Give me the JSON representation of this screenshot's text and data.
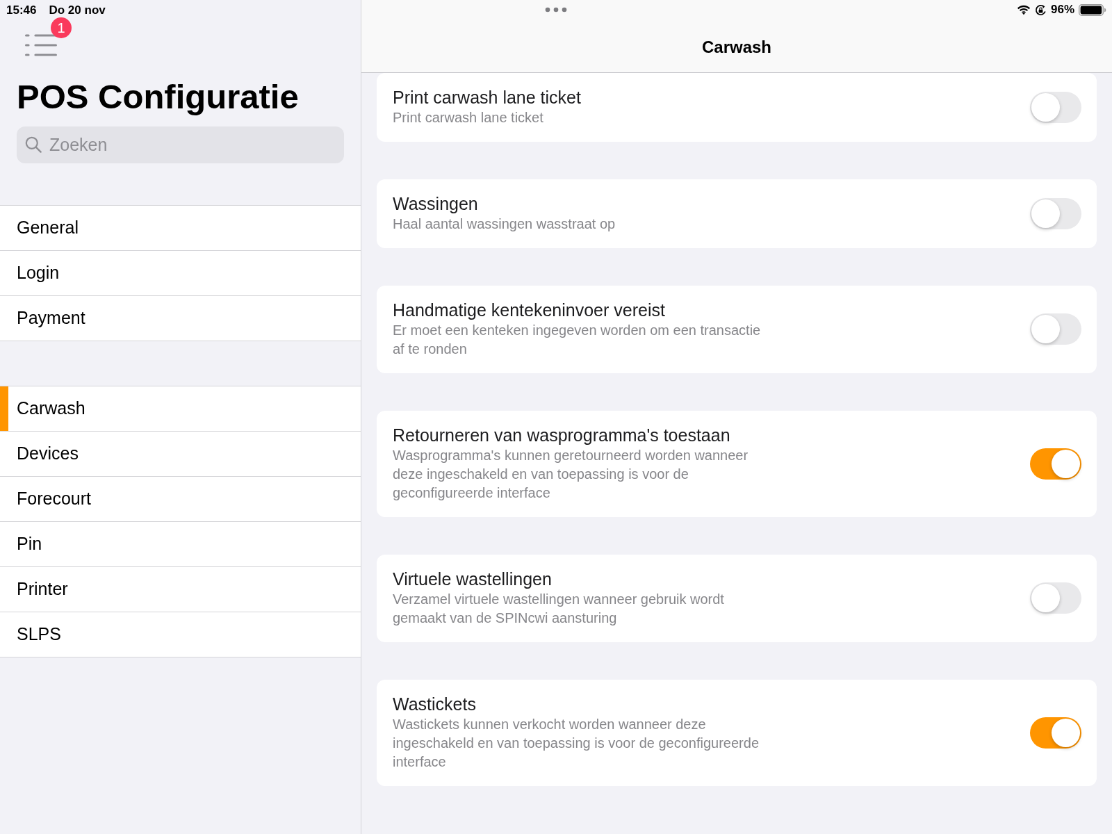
{
  "status_bar": {
    "time": "15:46",
    "date": "Do 20 nov",
    "battery": "96%"
  },
  "sidebar": {
    "menu_badge": "1",
    "title": "POS Configuratie",
    "search": {
      "placeholder": "Zoeken"
    },
    "groups": [
      {
        "items": [
          {
            "label": "General",
            "selected": false
          },
          {
            "label": "Login",
            "selected": false
          },
          {
            "label": "Payment",
            "selected": false
          }
        ]
      },
      {
        "items": [
          {
            "label": "Carwash",
            "selected": true
          },
          {
            "label": "Devices",
            "selected": false
          },
          {
            "label": "Forecourt",
            "selected": false
          },
          {
            "label": "Pin",
            "selected": false
          },
          {
            "label": "Printer",
            "selected": false
          },
          {
            "label": "SLPS",
            "selected": false
          }
        ]
      }
    ]
  },
  "detail": {
    "title": "Carwash",
    "settings": [
      {
        "title": "Print carwash lane ticket",
        "description": "Print carwash lane ticket",
        "on": false
      },
      {
        "title": "Wassingen",
        "description": "Haal aantal wassingen wasstraat op",
        "on": false
      },
      {
        "title": "Handmatige kentekeninvoer vereist",
        "description": "Er moet een kenteken ingegeven worden om een transactie af te ronden",
        "on": false
      },
      {
        "title": "Retourneren van wasprogramma's toestaan",
        "description": "Wasprogramma's kunnen geretourneerd worden wanneer deze ingeschakeld en van toepassing is voor de geconfigureerde interface",
        "on": true
      },
      {
        "title": "Virtuele wastellingen",
        "description": "Verzamel virtuele wastellingen wanneer gebruik wordt gemaakt van de SPINcwi aansturing",
        "on": false
      },
      {
        "title": "Wastickets",
        "description": "Wastickets kunnen verkocht worden wanneer deze ingeschakeld en van toepassing is voor de geconfigureerde interface",
        "on": true
      }
    ]
  }
}
